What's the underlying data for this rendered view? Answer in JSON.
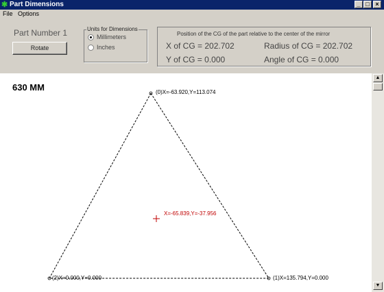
{
  "window": {
    "title": "Part Dimensions",
    "minimize_glyph": "_",
    "maximize_glyph": "□",
    "close_glyph": "×"
  },
  "menu": {
    "items": [
      "File",
      "Options"
    ]
  },
  "panel": {
    "part_number": "Part Number 1",
    "rotate_label": "Rotate"
  },
  "units": {
    "legend": "Units for Dimensions",
    "options": [
      {
        "label": "Millimeters",
        "selected": true
      },
      {
        "label": "Inches",
        "selected": false
      }
    ]
  },
  "cg": {
    "header": "Position of the CG of the part relative to the center of the mirror",
    "x_of_cg": "X of CG = 202.702",
    "radius_of_cg": "Radius of CG = 202.702",
    "y_of_cg": "Y of CG = 0.000",
    "angle_of_cg": "Angle of CG = 0.000"
  },
  "canvas": {
    "size_label": "630 MM",
    "vertices": [
      {
        "label": "(0)X=-63.920,Y=113.074"
      },
      {
        "label": "(1)X=135.794,Y=0.000"
      },
      {
        "label": "(2)X=0.000,Y=0.000"
      }
    ],
    "cg_marker": {
      "label": "X=-65.839,Y=-37.956",
      "color": "#c00000"
    }
  },
  "colors": {
    "titlebar": "#0a246a",
    "face": "#d4d0c8",
    "cg_marker": "#c00000"
  },
  "icons": {
    "app": "green-star-icon",
    "scroll_up": "scroll-up-arrow-icon",
    "scroll_down": "scroll-down-arrow-icon"
  }
}
